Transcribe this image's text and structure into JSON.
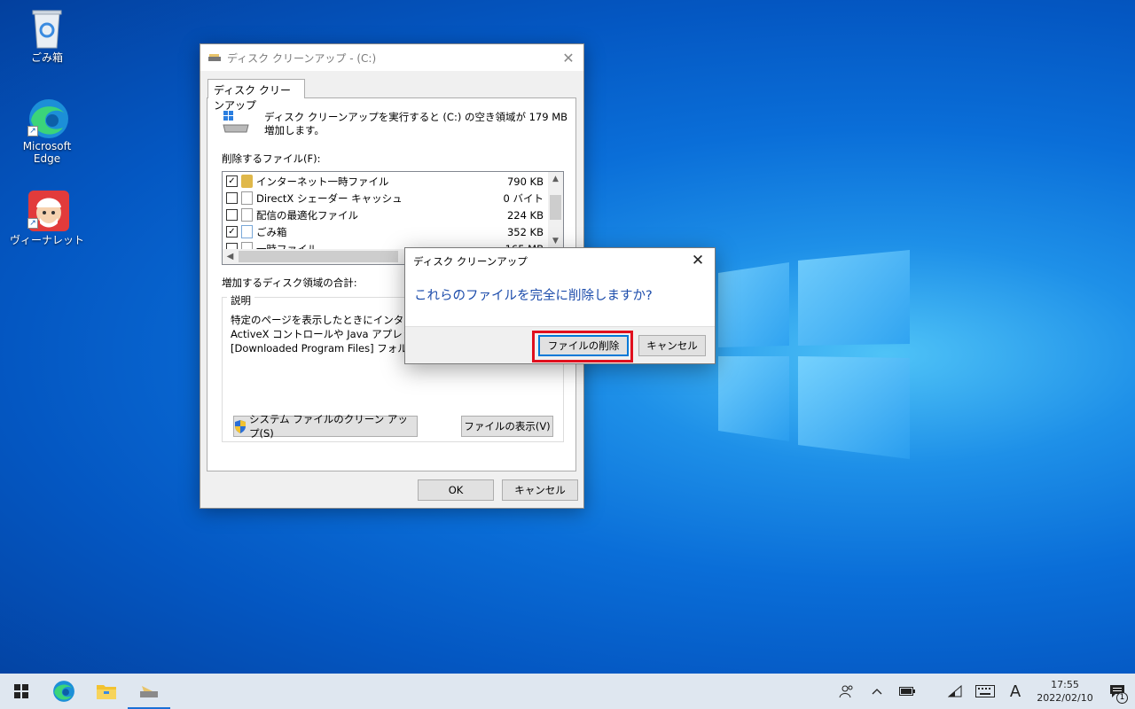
{
  "desktop": {
    "icons": [
      {
        "label": "ごみ箱",
        "icon": "recycle-bin-icon"
      },
      {
        "label": "Microsoft Edge",
        "icon": "edge-icon"
      },
      {
        "label": "ヴィーナレット",
        "icon": "app-character-icon"
      }
    ]
  },
  "cleanup_window": {
    "title": "ディスク クリーンアップ - (C:)",
    "tab": "ディスク クリーンアップ",
    "summary": "ディスク クリーンアップを実行すると (C:) の空き領域が 179 MB 増加します。",
    "files_label": "削除するファイル(F):",
    "files": [
      {
        "name": "インターネット一時ファイル",
        "size": "790 KB",
        "checked": true,
        "icon": "lock-icon"
      },
      {
        "name": "DirectX シェーダー キャッシュ",
        "size": "0 バイト",
        "checked": false,
        "icon": "file-icon"
      },
      {
        "name": "配信の最適化ファイル",
        "size": "224 KB",
        "checked": false,
        "icon": "file-icon"
      },
      {
        "name": "ごみ箱",
        "size": "352 KB",
        "checked": true,
        "icon": "recycle-bin-icon"
      },
      {
        "name": "一時ファイル",
        "size": "165 MB",
        "checked": false,
        "icon": "file-icon"
      }
    ],
    "gain_label": "増加するディスク領域の合計:",
    "description_title": "説明",
    "description_lines": [
      "特定のページを表示したときにインターネット",
      "ActiveX コントロールや Java アプレットです",
      "[Downloaded Program Files] フォルダーに"
    ],
    "system_cleanup_button": "システム ファイルのクリーン アップ(S)",
    "view_files_button": "ファイルの表示(V)",
    "ok_button": "OK",
    "cancel_button": "キャンセル"
  },
  "confirm_dialog": {
    "title": "ディスク クリーンアップ",
    "question": "これらのファイルを完全に削除しますか?",
    "delete_button": "ファイルの削除",
    "cancel_button": "キャンセル"
  },
  "taskbar": {
    "apps": [
      "start-icon",
      "edge-icon",
      "file-explorer-icon",
      "disk-cleanup-icon"
    ],
    "ime": "A",
    "time": "17:55",
    "date": "2022/02/10",
    "notification_count": "1"
  },
  "colors": {
    "highlight": "#e0101e",
    "question_text": "#1c4cab",
    "accent": "#1a6fd6"
  }
}
